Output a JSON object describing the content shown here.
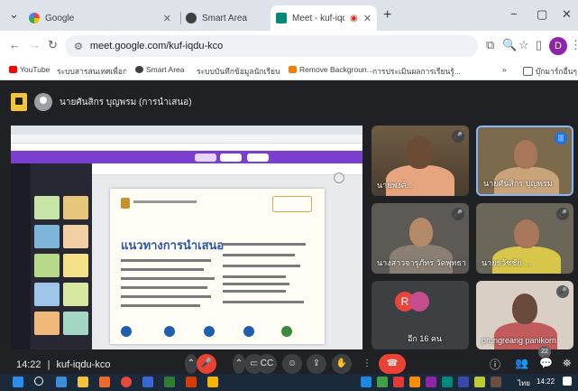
{
  "browser": {
    "tabs": [
      {
        "title": "Google",
        "active": false
      },
      {
        "title": "Smart Area",
        "active": false
      },
      {
        "title": "Meet - kuf-iqdu-kco",
        "active": true
      }
    ],
    "url": "meet.google.com/kuf-iqdu-kco",
    "profile_initial": "D",
    "bookmarks": [
      "YouTube",
      "ระบบสารสนเทศเพื่อการบริหารจัดการ...",
      "Smart Area",
      "ระบบบันทึกข้อมูลนักเรียน...",
      "Remove Backgroun...",
      "การประเมินผลการเรียนรู้...",
      "บุ๊กมาร์กอื่นๆ"
    ],
    "bookmarks_more": "»"
  },
  "meet": {
    "presenter_name": "นายศันสิกร บุญพรม (การนำเสนอ)",
    "slide_heading": "แนวทางการนำเสนอ",
    "participants": [
      {
        "name": "นายพงศ์...",
        "mic": "🎤"
      },
      {
        "name": "นายศันสิกร บุญพรม",
        "mic": "|||"
      },
      {
        "name": "นางสาวจารุภัทร วัดพุทธา",
        "mic": "🎤"
      },
      {
        "name": "นายธวัชชัย ...",
        "mic": "🎤"
      },
      {
        "name": "prungreang panikorn",
        "mic": "🎤"
      }
    ],
    "others": {
      "initial": "R",
      "label": "อีก 16 คน"
    },
    "meeting_time": "14:22",
    "meeting_code": "kuf-iqdu-kco",
    "participant_count": "22"
  },
  "taskbar": {
    "language": "ไทย",
    "time": "14:22"
  },
  "colors": {
    "meet_bg": "#202124",
    "accent_blue": "#1a73e8",
    "hangup_red": "#ea4335",
    "canva_purple": "#7b3fd0"
  }
}
